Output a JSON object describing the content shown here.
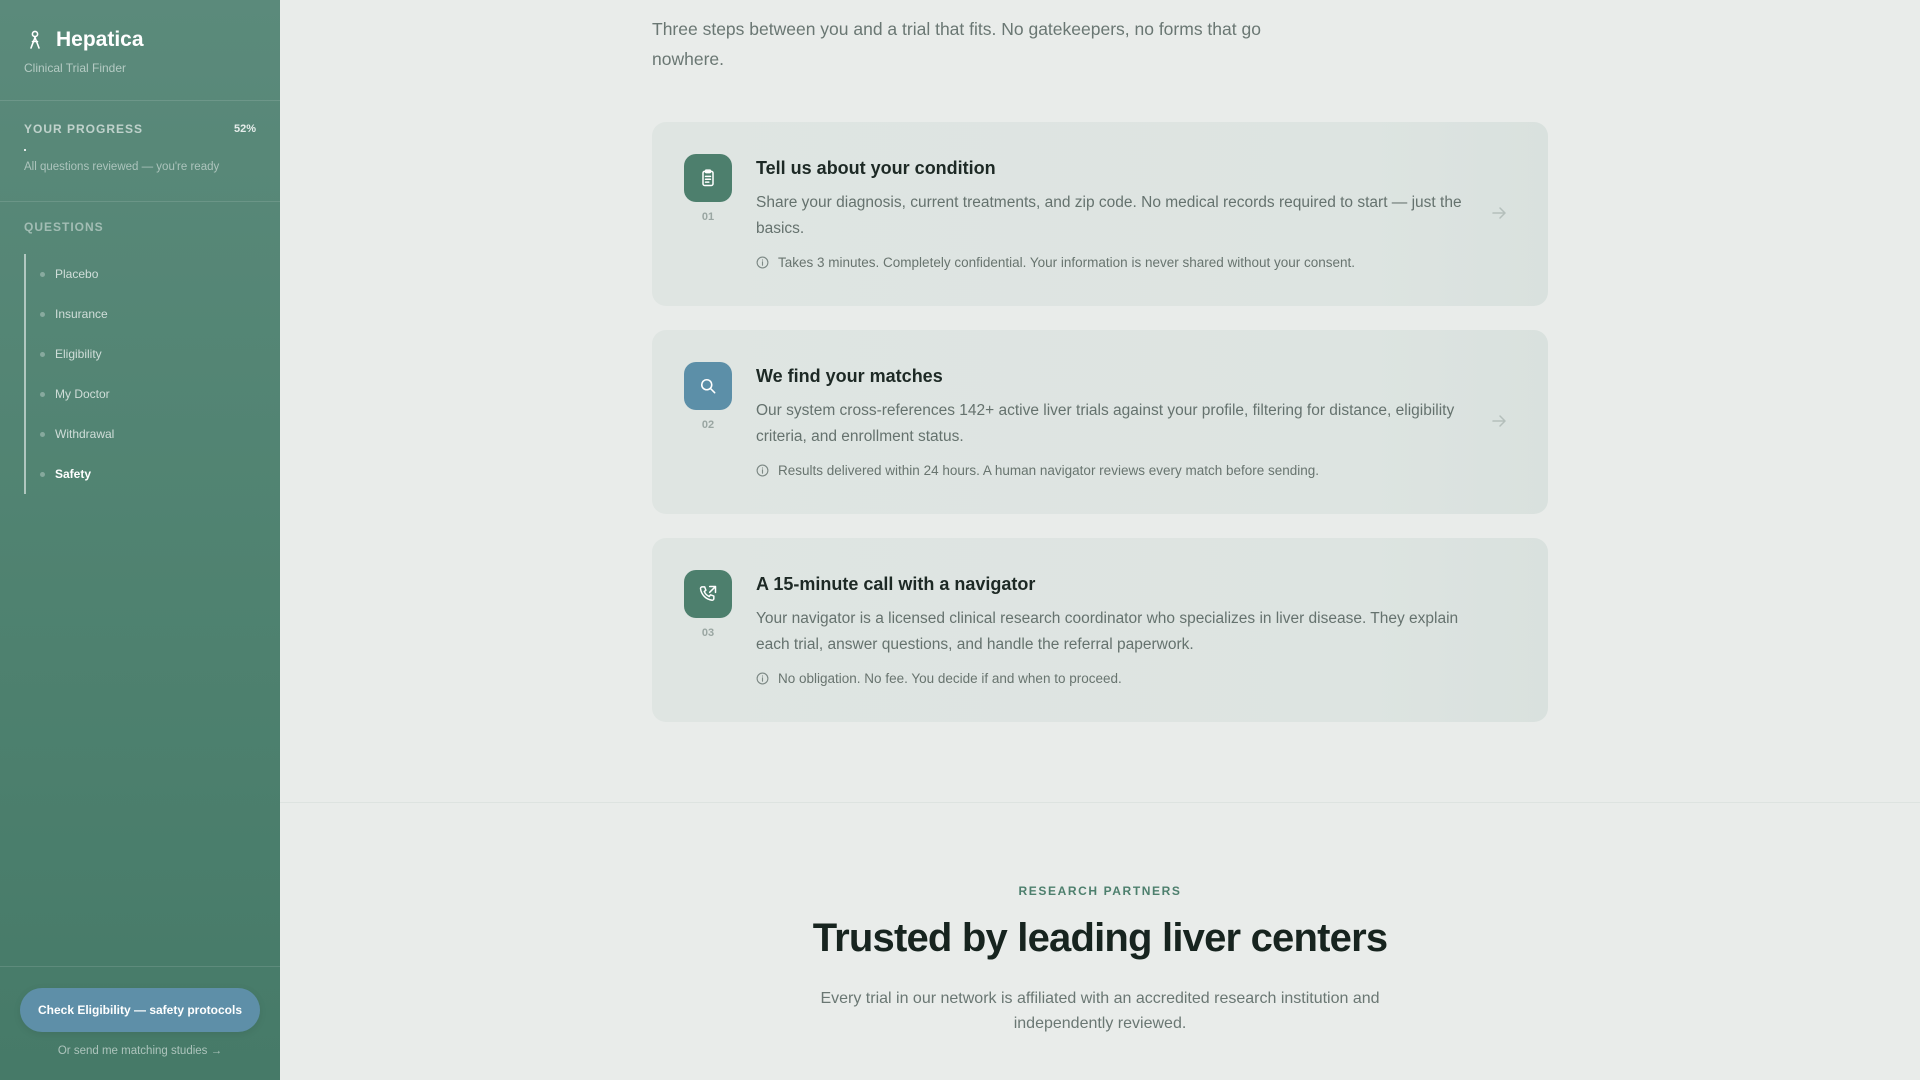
{
  "sidebar": {
    "brand": {
      "name": "Hepatica",
      "subtitle": "Clinical Trial Finder",
      "icon": "person-ribbon-icon"
    },
    "progress": {
      "title": "YOUR PROGRESS",
      "percent_label": "52%",
      "note": "All questions reviewed — you're ready"
    },
    "questions_title": "QUESTIONS",
    "questions": [
      {
        "label": "Placebo"
      },
      {
        "label": "Insurance"
      },
      {
        "label": "Eligibility"
      },
      {
        "label": "My Doctor"
      },
      {
        "label": "Withdrawal"
      },
      {
        "label": "Safety",
        "active": true
      }
    ],
    "cta_button": "Check Eligibility — safety protocols",
    "cta_link": "Or send me matching studies →"
  },
  "main": {
    "intro": "Three steps between you and a trial that fits. No gatekeepers, no forms that go nowhere.",
    "steps": [
      {
        "number": "01",
        "icon": "clipboard-icon",
        "title": "Tell us about your condition",
        "description": "Share your diagnosis, current treatments, and zip code. No medical records required to start — just the basics.",
        "note": "Takes 3 minutes. Completely confidential. Your information is never shared without your consent."
      },
      {
        "number": "02",
        "icon": "search-icon",
        "title": "We find your matches",
        "description": "Our system cross-references 142+ active liver trials against your profile, filtering for distance, eligibility criteria, and enrollment status.",
        "note": "Results delivered within 24 hours. A human navigator reviews every match before sending."
      },
      {
        "number": "03",
        "icon": "phone-call-icon",
        "title": "A 15-minute call with a navigator",
        "description": "Your navigator is a licensed clinical research coordinator who specializes in liver disease. They explain each trial, answer questions, and handle the referral paperwork.",
        "note": "No obligation. No fee. You decide if and when to proceed."
      }
    ],
    "partners": {
      "eyebrow": "RESEARCH PARTNERS",
      "title": "Trusted by leading liver centers",
      "description": "Every trial in our network is affiliated with an accredited research institution and independently reviewed."
    }
  },
  "colors": {
    "sidebar": "#4f8270",
    "accent_green": "#4d7f6d",
    "accent_blue": "#5c8fa8",
    "background": "#e9ecea"
  }
}
